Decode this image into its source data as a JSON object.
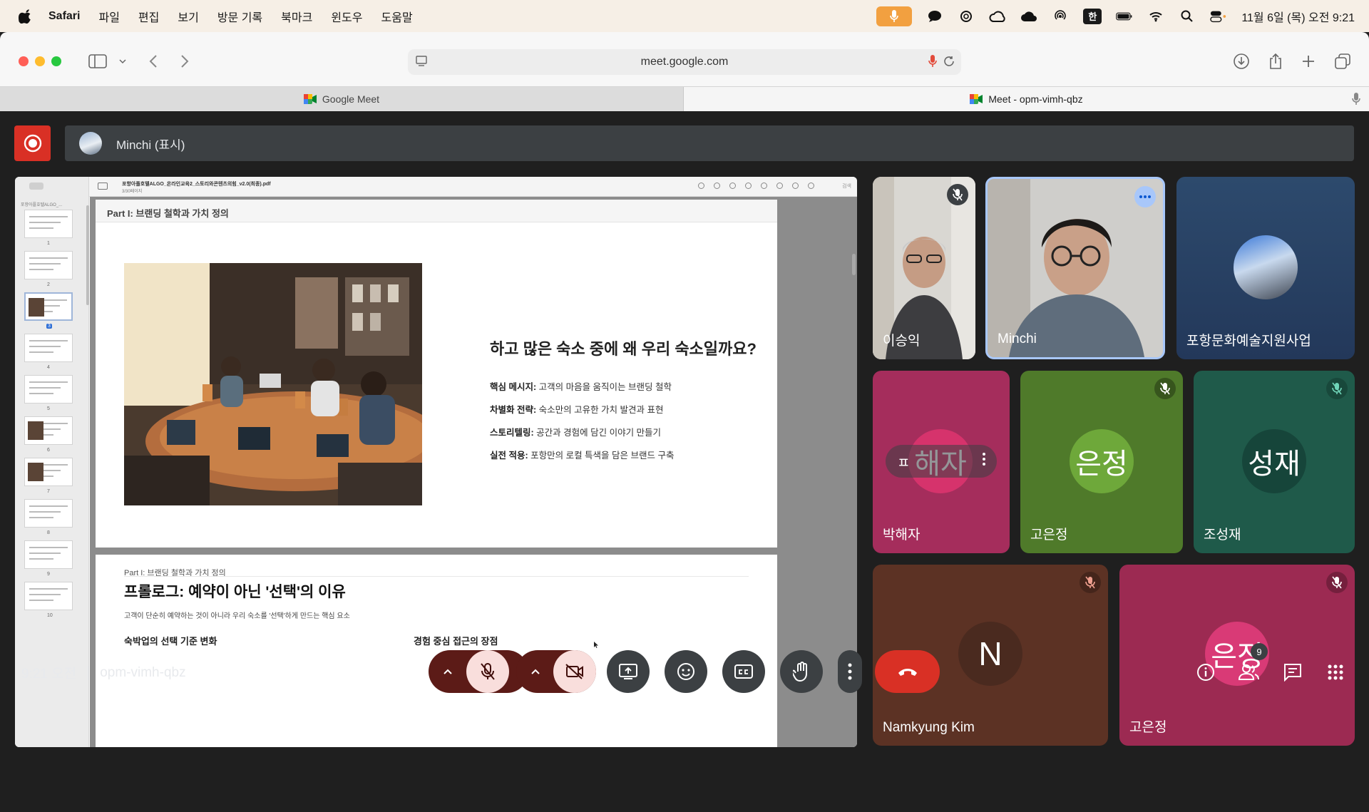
{
  "menubar": {
    "app": "Safari",
    "items": [
      "파일",
      "편집",
      "보기",
      "방문 기록",
      "북마크",
      "윈도우",
      "도움말"
    ],
    "han": "한",
    "clock": "11월 6일 (목) 오전 9:21"
  },
  "browser": {
    "url": "meet.google.com",
    "tabs": [
      {
        "label": "Google Meet"
      },
      {
        "label": "Meet - opm-vimh-qbz"
      }
    ]
  },
  "meet": {
    "presenter_label": "Minchi (표시)",
    "time": "9:21 오전",
    "meeting_code": "opm-vimh-qbz",
    "participant_count": "9",
    "colors": {
      "record": "#d93025",
      "muted_ctrl": "#f9dedc",
      "hangup": "#d93025",
      "ctrl_bg": "#3c4043"
    }
  },
  "pdf": {
    "filename": "포항아플호텔ALGO_온라인교육2_스토리와콘텐츠의힘_v2.0(최종).pdf",
    "page_info": "3/30페이지",
    "search_placeholder": "검색",
    "sidebar_title": "포항아플호텔ALGO_...",
    "thumbs": [
      "1",
      "2",
      "3",
      "4",
      "5",
      "6",
      "7",
      "8",
      "9",
      "10"
    ],
    "selected_page": "3",
    "page1": {
      "header": "Part I: 브랜딩 철학과 가치 정의",
      "title": "하고 많은 숙소 중에 왜 우리 숙소일까요?",
      "bullets": [
        {
          "k": "핵심 메시지:",
          "v": " 고객의 마음을 움직이는 브랜딩 철학"
        },
        {
          "k": "차별화 전략:",
          "v": " 숙소만의 고유한 가치 발견과 표현"
        },
        {
          "k": "스토리텔링:",
          "v": " 공간과 경험에 담긴 이야기 만들기"
        },
        {
          "k": "실전 적용:",
          "v": " 포항만의 로컬 특색을 담은 브랜드 구축"
        }
      ]
    },
    "page2": {
      "sub": "Part I: 브랜딩 철학과 가치 정의",
      "title": "프롤로그: 예약이 아닌 '선택'의 이유",
      "desc": "고객이 단순히 예약하는 것이 아니라 우리 숙소를 '선택'하게 만드는 핵심 요소",
      "col1": "숙박업의 선택 기준 변화",
      "col2": "경험 중심 접근의 장점"
    }
  },
  "participants": [
    {
      "name": "이승익",
      "muted": true
    },
    {
      "name": "Minchi",
      "speaking": true
    },
    {
      "name": "포항문화예술지원사업"
    },
    {
      "name": "박해자",
      "avatar": "해자",
      "hover_label": "ㅍ"
    },
    {
      "name": "고은정",
      "avatar": "은정",
      "muted": true
    },
    {
      "name": "조성재",
      "avatar": "성재",
      "muted": true
    },
    {
      "name": "Namkyung Kim",
      "avatar": "N",
      "muted": true
    },
    {
      "name": "고은정",
      "avatar": "은정",
      "muted": true
    }
  ]
}
